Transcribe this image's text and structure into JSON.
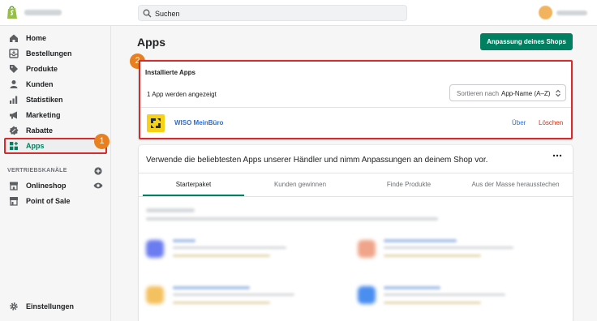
{
  "topbar": {
    "search_placeholder": "Suchen",
    "logo_icon": "shopify-bag-icon"
  },
  "sidebar": {
    "items": [
      {
        "label": "Home",
        "icon": "home-icon"
      },
      {
        "label": "Bestellungen",
        "icon": "orders-icon"
      },
      {
        "label": "Produkte",
        "icon": "tag-icon"
      },
      {
        "label": "Kunden",
        "icon": "person-icon"
      },
      {
        "label": "Statistiken",
        "icon": "bar-chart-icon"
      },
      {
        "label": "Marketing",
        "icon": "megaphone-icon"
      },
      {
        "label": "Rabatte",
        "icon": "discount-icon"
      },
      {
        "label": "Apps",
        "icon": "apps-icon"
      }
    ],
    "channels_title": "VERTRIEBSKANÄLE",
    "channels": [
      {
        "label": "Onlineshop",
        "icon": "store-icon"
      },
      {
        "label": "Point of Sale",
        "icon": "pos-icon"
      }
    ],
    "settings_label": "Einstellungen"
  },
  "annotations": {
    "badge_1": "1",
    "badge_2": "2"
  },
  "main": {
    "title": "Apps",
    "customize_button": "Anpassung deines Shops",
    "installed": {
      "title": "Installierte Apps",
      "count_text": "1 App werden angezeigt",
      "sort_label": "Sortieren nach",
      "sort_value": "App-Name (A–Z)",
      "apps": [
        {
          "name": "WISO MeinBüro",
          "about": "Über",
          "delete": "Löschen"
        }
      ]
    },
    "recommendations": {
      "title": "Verwende die beliebtesten Apps unserer Händler und nimm Anpassungen an deinem Shop vor.",
      "tabs": [
        "Starterpaket",
        "Kunden gewinnen",
        "Finde Produkte",
        "Aus der Masse herausstechen"
      ]
    }
  },
  "colors": {
    "accent": "#008060",
    "highlight": "#d72c2d",
    "badge": "#e8801f",
    "link": "#2c6ecb",
    "danger": "#d72c0d"
  }
}
